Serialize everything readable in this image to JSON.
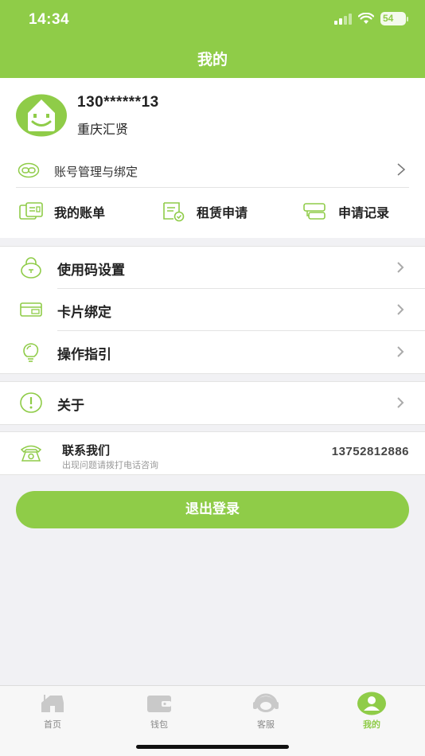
{
  "status_bar": {
    "time": "14:34",
    "battery": "54"
  },
  "header": {
    "title": "我的"
  },
  "profile": {
    "phone": "130******13",
    "company": "重庆汇贤",
    "account_link": "账号管理与绑定"
  },
  "quick_actions": [
    {
      "label": "我的账单",
      "icon": "bill-icon"
    },
    {
      "label": "租赁申请",
      "icon": "lease-application-icon"
    },
    {
      "label": "申请记录",
      "icon": "application-record-icon"
    }
  ],
  "menu": {
    "passcode": "使用码设置",
    "card_binding": "卡片绑定",
    "guide": "操作指引",
    "about": "关于"
  },
  "contact": {
    "label": "联系我们",
    "subtitle": "出现问题请拨打电话咨询",
    "phone": "13752812886"
  },
  "logout_label": "退出登录",
  "tabs": [
    {
      "label": "首页",
      "icon": "home-icon",
      "active": false
    },
    {
      "label": "钱包",
      "icon": "wallet-icon",
      "active": false
    },
    {
      "label": "客服",
      "icon": "customer-service-icon",
      "active": false
    },
    {
      "label": "我的",
      "icon": "profile-icon",
      "active": true
    }
  ],
  "colors": {
    "accent": "#8fcc48",
    "background": "#f1f1f4",
    "inactive_icon": "#c9c9c9"
  }
}
